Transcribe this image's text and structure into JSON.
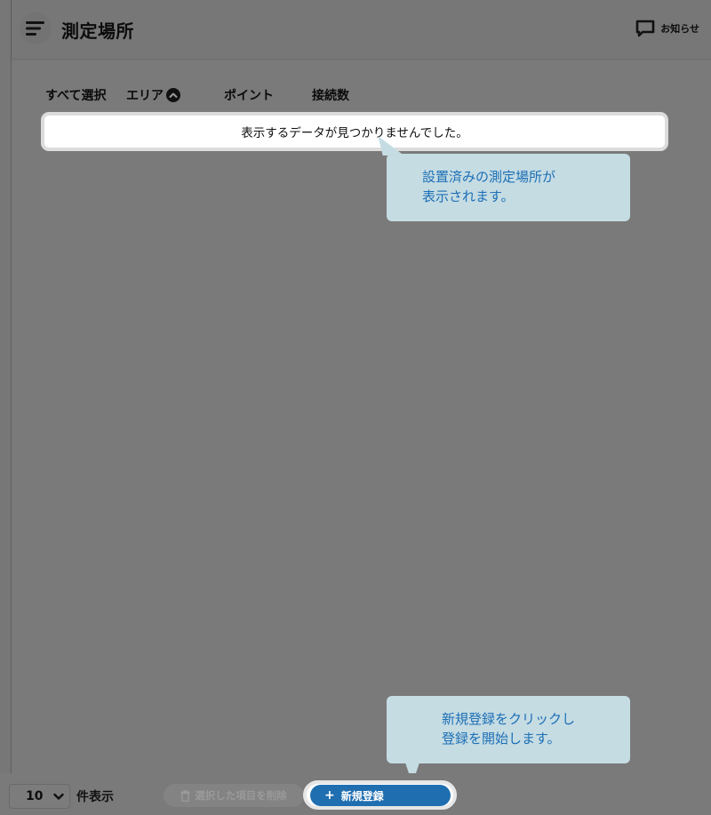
{
  "header": {
    "title": "測定場所",
    "notice_label": "お知らせ"
  },
  "table": {
    "columns": {
      "select_all": "すべて選択",
      "area": "エリア",
      "point": "ポイント",
      "connections": "接続数"
    },
    "empty_message": "表示するデータが見つかりませんでした。"
  },
  "callouts": {
    "top": [
      "設置済みの測定場所が",
      "表示されます。"
    ],
    "bottom": [
      "新規登録をクリックし",
      "登録を開始します。"
    ]
  },
  "footer": {
    "per_page_value": "10",
    "per_page_label": "件表示",
    "delete_label": "選択した項目を削除",
    "new_label": "新規登録"
  },
  "colors": {
    "accent": "#1f6eb0",
    "callout_bg": "#c5dce3",
    "callout_text": "#1d6fb6",
    "overlay": "#7a7a7a"
  },
  "icons": {
    "menu": "menu-icon",
    "notice": "chat-bubble-icon",
    "sort": "sort-up-icon",
    "chevron": "chevron-down-icon",
    "trash": "trash-icon",
    "plus": "plus-icon"
  }
}
